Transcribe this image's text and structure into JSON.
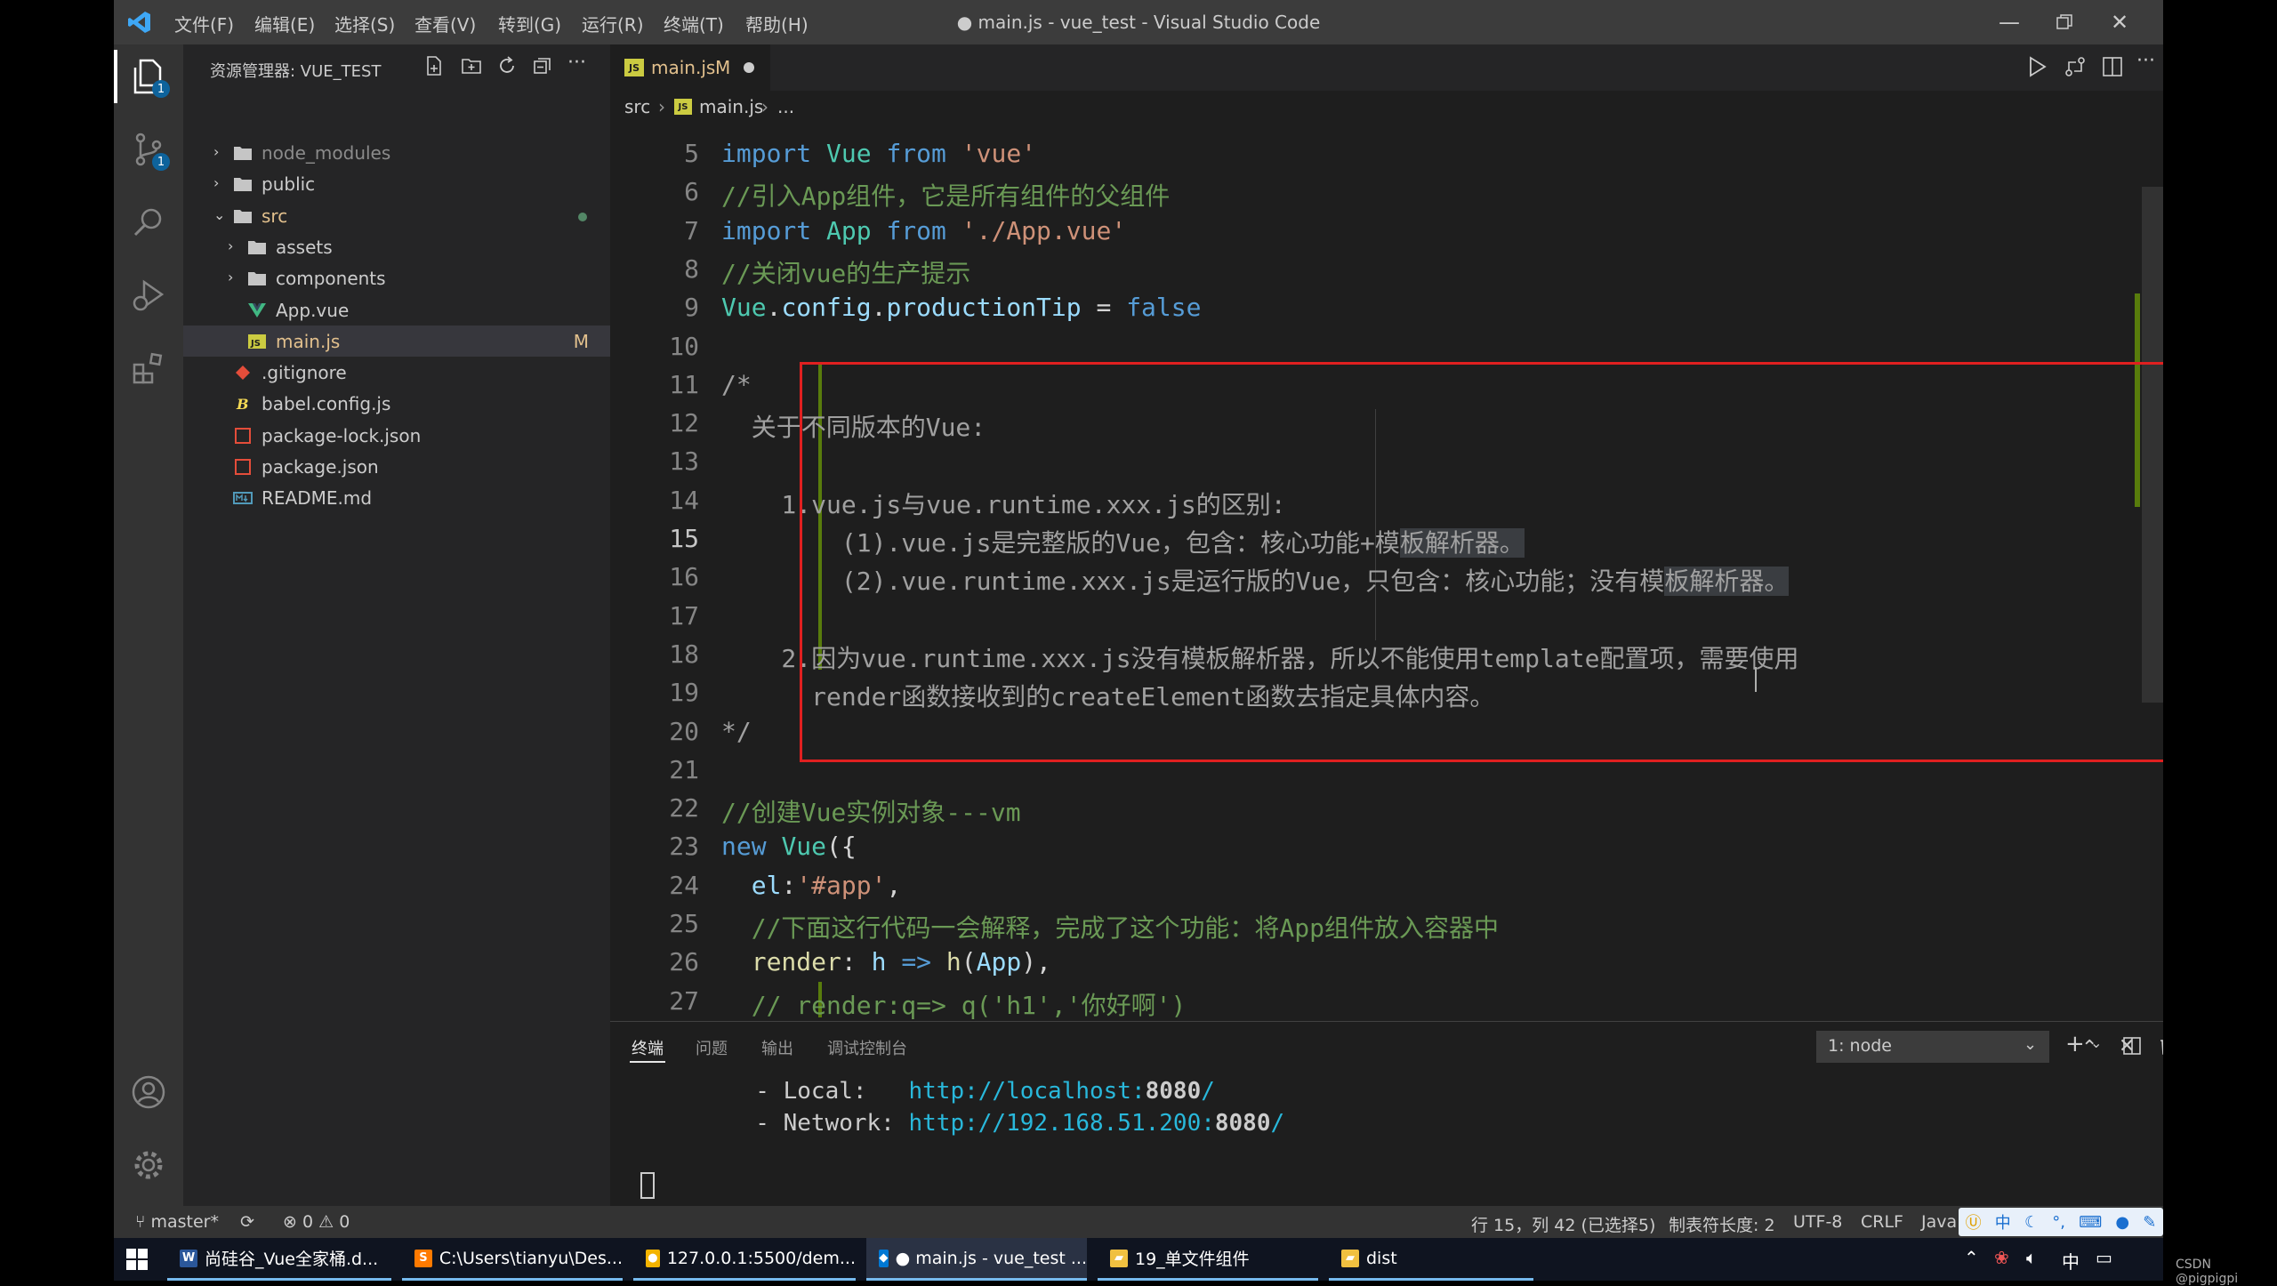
{
  "window": {
    "title": "● main.js - vue_test - Visual Studio Code",
    "menu": [
      "文件(F)",
      "编辑(E)",
      "选择(S)",
      "查看(V)",
      "转到(G)",
      "运行(R)",
      "终端(T)",
      "帮助(H)"
    ]
  },
  "activity_bar": {
    "explorer_badge": "1",
    "scm_badge": "1"
  },
  "sidebar": {
    "header": "资源管理器: VUE_TEST",
    "items": [
      {
        "label": "node_modules",
        "type": "folder",
        "level": 0,
        "expanded": false,
        "dim": true
      },
      {
        "label": "public",
        "type": "folder",
        "level": 0,
        "expanded": false
      },
      {
        "label": "src",
        "type": "folder",
        "level": 0,
        "expanded": true,
        "modified_dot": true
      },
      {
        "label": "assets",
        "type": "folder",
        "level": 1,
        "expanded": false
      },
      {
        "label": "components",
        "type": "folder",
        "level": 1,
        "expanded": false
      },
      {
        "label": "App.vue",
        "type": "vue",
        "level": 1
      },
      {
        "label": "main.js",
        "type": "js",
        "level": 1,
        "selected": true,
        "flag": "M"
      },
      {
        "label": ".gitignore",
        "type": "git",
        "level": 0
      },
      {
        "label": "babel.config.js",
        "type": "babel",
        "level": 0
      },
      {
        "label": "package-lock.json",
        "type": "json",
        "level": 0
      },
      {
        "label": "package.json",
        "type": "json",
        "level": 0
      },
      {
        "label": "README.md",
        "type": "md",
        "level": 0
      }
    ]
  },
  "editor": {
    "tab": {
      "label": "main.js",
      "flag": "M",
      "icon": "JS"
    },
    "breadcrumb": {
      "folder": "src",
      "file": "main.js",
      "tail": "..."
    },
    "lines": [
      {
        "n": "5",
        "html": "<span class=\"kw\">import</span> <span class=\"cls\">Vue</span> <span class=\"kw\">from</span> <span class=\"str\">'vue'</span>"
      },
      {
        "n": "6",
        "html": "<span class=\"cm\">//引入App组件，它是所有组件的父组件</span>"
      },
      {
        "n": "7",
        "html": "<span class=\"kw\">import</span> <span class=\"cls\">App</span> <span class=\"kw\">from</span> <span class=\"str\">'./App.vue'</span>"
      },
      {
        "n": "8",
        "html": "<span class=\"cm\">//关闭vue的生产提示</span>"
      },
      {
        "n": "9",
        "html": "<span class=\"cls\">Vue</span>.<span class=\"prop\">config</span>.<span class=\"prop\">productionTip</span> = <span class=\"bool\">false</span>"
      },
      {
        "n": "10",
        "html": ""
      },
      {
        "n": "11",
        "html": "<span class=\"cm2\">/*</span>"
      },
      {
        "n": "12",
        "html": "<span class=\"cm2\">  关于不同版本的Vue:</span>"
      },
      {
        "n": "13",
        "html": ""
      },
      {
        "n": "14",
        "html": "<span class=\"cm2\">    1.vue.js与vue.runtime.xxx.js的区别:</span>"
      },
      {
        "n": "15",
        "html": "<span class=\"cm2\">        (1).vue.js是完整版的Vue，包含：核心功能+模<span class=\"hl\">板解析器。</span></span>",
        "active": true
      },
      {
        "n": "16",
        "html": "<span class=\"cm2\">        (2).vue.runtime.xxx.js是运行版的Vue，只包含：核心功能；没有模<span class=\"hl\">板解析器。</span></span>"
      },
      {
        "n": "17",
        "html": ""
      },
      {
        "n": "18",
        "html": "<span class=\"cm2\">    2.因为vue.runtime.xxx.js没有模板解析器，所以不能使用template配置项，需要使用</span>"
      },
      {
        "n": "19",
        "html": "<span class=\"cm2\">      render函数接收到的createElement函数去指定具体内容。</span>"
      },
      {
        "n": "20",
        "html": "<span class=\"cm2\">*/</span>"
      },
      {
        "n": "21",
        "html": ""
      },
      {
        "n": "22",
        "html": "<span class=\"cm\">//创建Vue实例对象---vm</span>"
      },
      {
        "n": "23",
        "html": "<span class=\"kw\">new</span> <span class=\"cls\">Vue</span>({"
      },
      {
        "n": "24",
        "html": "  <span class=\"prop\">el</span>:<span class=\"str\">'#app'</span>,"
      },
      {
        "n": "25",
        "html": "  <span class=\"cm\">//下面这行代码一会解释，完成了这个功能：将App组件放入容器中</span>"
      },
      {
        "n": "26",
        "html": "  <span class=\"fn\">render</span>: <span class=\"prop\">h</span> <span class=\"kw\">=&gt;</span> <span class=\"fn\">h</span>(<span class=\"prop\">App</span>),"
      },
      {
        "n": "27",
        "html": "  <span class=\"cm\">// render:q=&gt; q('h1','你好啊')</span>"
      }
    ]
  },
  "panel": {
    "tabs": [
      "终端",
      "问题",
      "输出",
      "调试控制台"
    ],
    "active_tab": "终端",
    "terminal_select": "1: node",
    "lines": [
      {
        "label": "  - Local:   ",
        "url": "http://localhost:",
        "port": "8080",
        "tail": "/"
      },
      {
        "label": "  - Network: ",
        "url": "http://192.168.51.200:",
        "port": "8080",
        "tail": "/"
      }
    ]
  },
  "statusbar": {
    "branch": "master*",
    "errors": "0",
    "warnings": "0",
    "position": "行 15，列 42 (已选择5)",
    "tab_size": "制表符长度: 2",
    "encoding": "UTF-8",
    "eol": "CRLF",
    "language": "Java"
  },
  "taskbar": {
    "items": [
      {
        "label": "尚硅谷_Vue全家桶.d...",
        "icon": "W",
        "color": "#2b579a"
      },
      {
        "label": "C:\\Users\\tianyu\\Des...",
        "icon": "S",
        "color": "#ff7a00"
      },
      {
        "label": "127.0.0.1:5500/dem...",
        "icon": "●",
        "color": "#f4b400"
      },
      {
        "label": "● main.js - vue_test ...",
        "icon": "◆",
        "color": "#0078d4"
      },
      {
        "label": "19_单文件组件",
        "icon": "▰",
        "color": "#f0c040"
      },
      {
        "label": "dist",
        "icon": "▰",
        "color": "#f0c040"
      }
    ],
    "ime": "中",
    "watermark": "CSDN @pigpigpi"
  },
  "colors": {
    "accent": "#0078d4",
    "highlight_box": "#e02020",
    "modified": "#e2c08d"
  }
}
